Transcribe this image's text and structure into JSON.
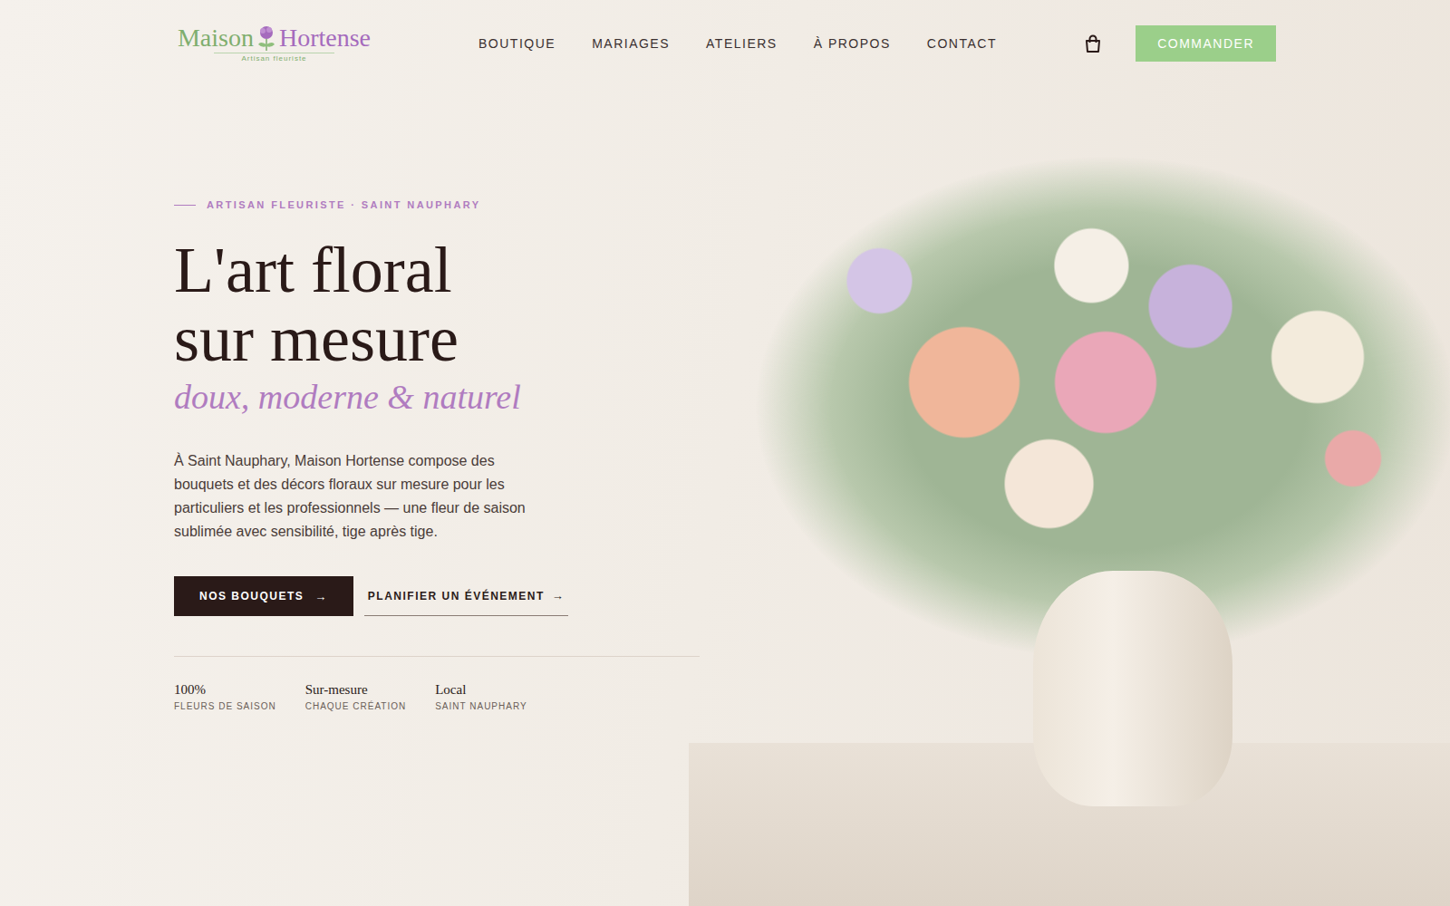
{
  "logo": {
    "word1": "Maison",
    "word2": "Hortense",
    "tagline": "Artisan fleuriste"
  },
  "nav": [
    {
      "label": "BOUTIQUE"
    },
    {
      "label": "MARIAGES"
    },
    {
      "label": "ATELIERS"
    },
    {
      "label": "À PROPOS"
    },
    {
      "label": "CONTACT"
    }
  ],
  "order_button": "COMMANDER",
  "hero": {
    "eyebrow": "ARTISAN FLEURISTE · SAINT NAUPHARY",
    "title_lines": [
      "L'art floral",
      "sur mesure"
    ],
    "script": "doux, moderne & naturel",
    "description": "À Saint Nauphary, Maison Hortense compose des bouquets et des décors floraux sur mesure pour les particuliers et les professionnels — une fleur de saison sublimée avec sensibilité, tige après tige.",
    "primary_button": {
      "label": "NOS BOUQUETS",
      "arrow": "→"
    },
    "secondary_button": {
      "label": "PLANIFIER UN ÉVÉNEMENT",
      "arrow": "→"
    },
    "stats": [
      {
        "value": "100%",
        "label": "FLEURS DE SAISON"
      },
      {
        "value": "Sur-mesure",
        "label": "CHAQUE CRÉATION"
      },
      {
        "value": "Local",
        "label": "SAINT NAUPHARY"
      }
    ]
  }
}
